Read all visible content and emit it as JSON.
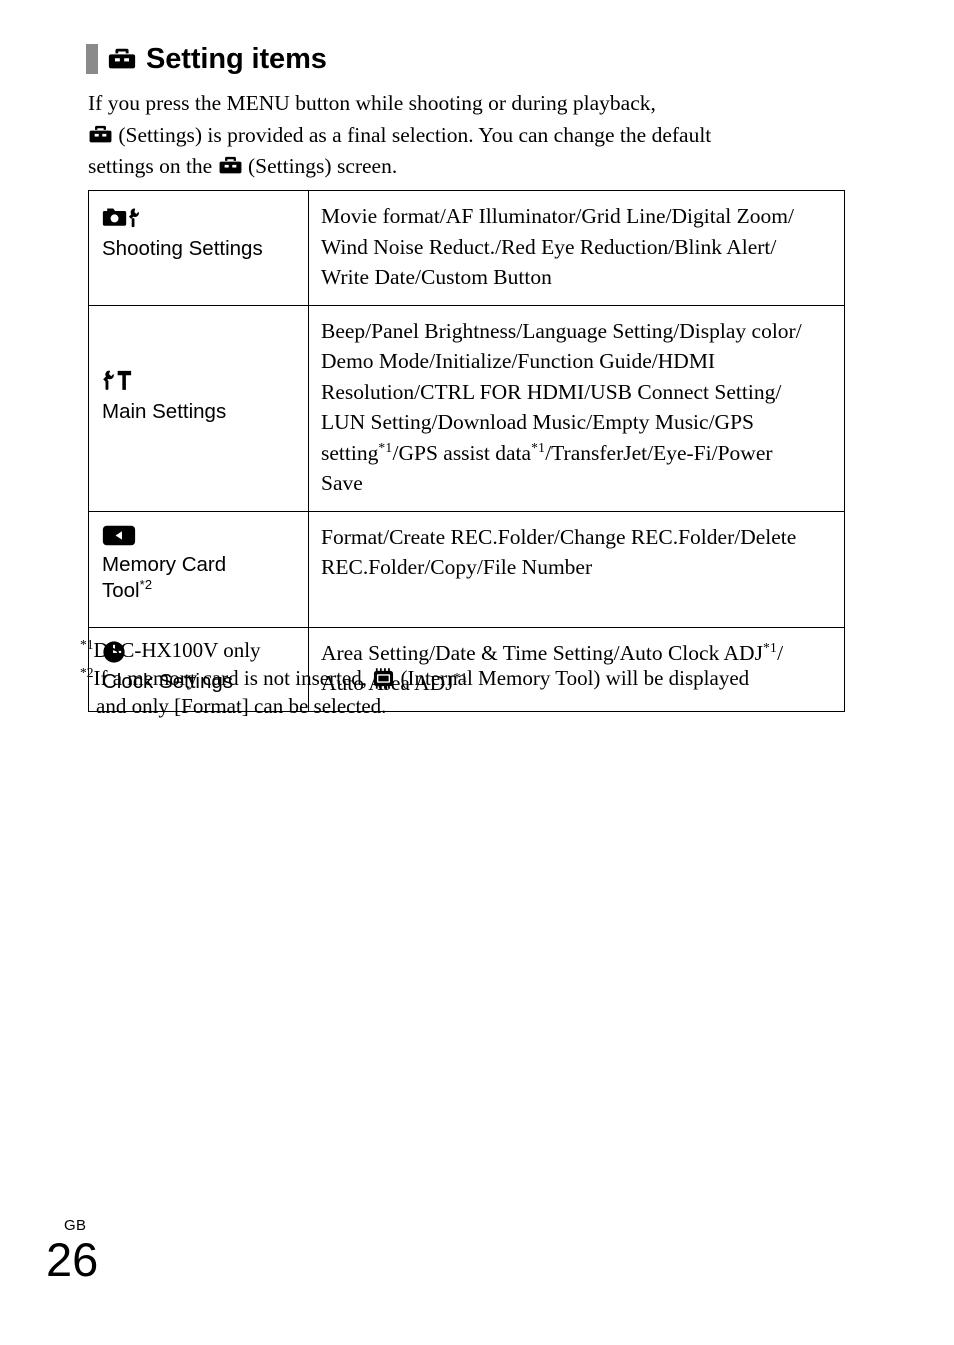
{
  "heading": {
    "icon": "toolbox-icon",
    "title": "Setting items"
  },
  "intro": {
    "line1": "If you press the MENU button while shooting or during playback,",
    "line2_after_icon": "(Settings) is provided as a final selection. You can change the default",
    "line3_before_icon": "settings on the",
    "line3_after_icon": "(Settings) screen."
  },
  "table": {
    "rows": [
      {
        "icon": "camera-with-wrench-icon",
        "label": "Shooting Settings",
        "value_lines": [
          "Movie format/AF Illuminator/Grid Line/Digital Zoom/",
          "Wind Noise Reduct./Red Eye Reduction/Blink Alert/",
          "Write Date/Custom Button"
        ]
      },
      {
        "icon": "wrench-and-hammer-icon",
        "label": "Main Settings",
        "value_lines": [
          "Beep/Panel Brightness/Language Setting/Display color/",
          "Demo Mode/Initialize/Function Guide/HDMI",
          "Resolution/CTRL FOR HDMI/USB Connect Setting/",
          "LUN Setting/Download Music/Empty Music/GPS",
          "setting*1/GPS assist data*1/TransferJet/Eye-Fi/Power",
          "Save"
        ],
        "value_line5_a": "setting",
        "value_line5_sup1": "*1",
        "value_line5_b": "/GPS assist data",
        "value_line5_sup2": "*1",
        "value_line5_c": "/TransferJet/Eye-Fi/Power"
      },
      {
        "icon": "memory-card-icon",
        "label_line1": "Memory Card",
        "label_line2": "Tool",
        "label_sup": "*2",
        "value_lines": [
          "Format/Create REC.Folder/Change REC.Folder/Delete",
          "REC.Folder/Copy/File Number"
        ]
      },
      {
        "icon": "clock-icon",
        "label": "Clock Settings",
        "value_line1_a": "Area Setting/Date & Time Setting/Auto Clock ADJ",
        "value_line1_sup": "*1",
        "value_line1_b": "/",
        "value_line2_a": "Auto Area ADJ",
        "value_line2_sup": "*1"
      }
    ]
  },
  "footnotes": {
    "fn1_mark": "*1",
    "fn1_text": "DSC-HX100V only",
    "fn2_mark": "*2",
    "fn2_text_before_icon": "If a memory card is not inserted,",
    "fn2_icon": "internal-memory-chip-icon",
    "fn2_text_after_icon": "(Internal Memory Tool) will be displayed",
    "fn2_line2": "and only [Format] can be selected."
  },
  "page_number": {
    "region": "GB",
    "number": "26"
  },
  "colors": {
    "text": "#000000",
    "heading_bar": "#8a8a8a",
    "table_border": "#000000",
    "background": "#ffffff"
  }
}
